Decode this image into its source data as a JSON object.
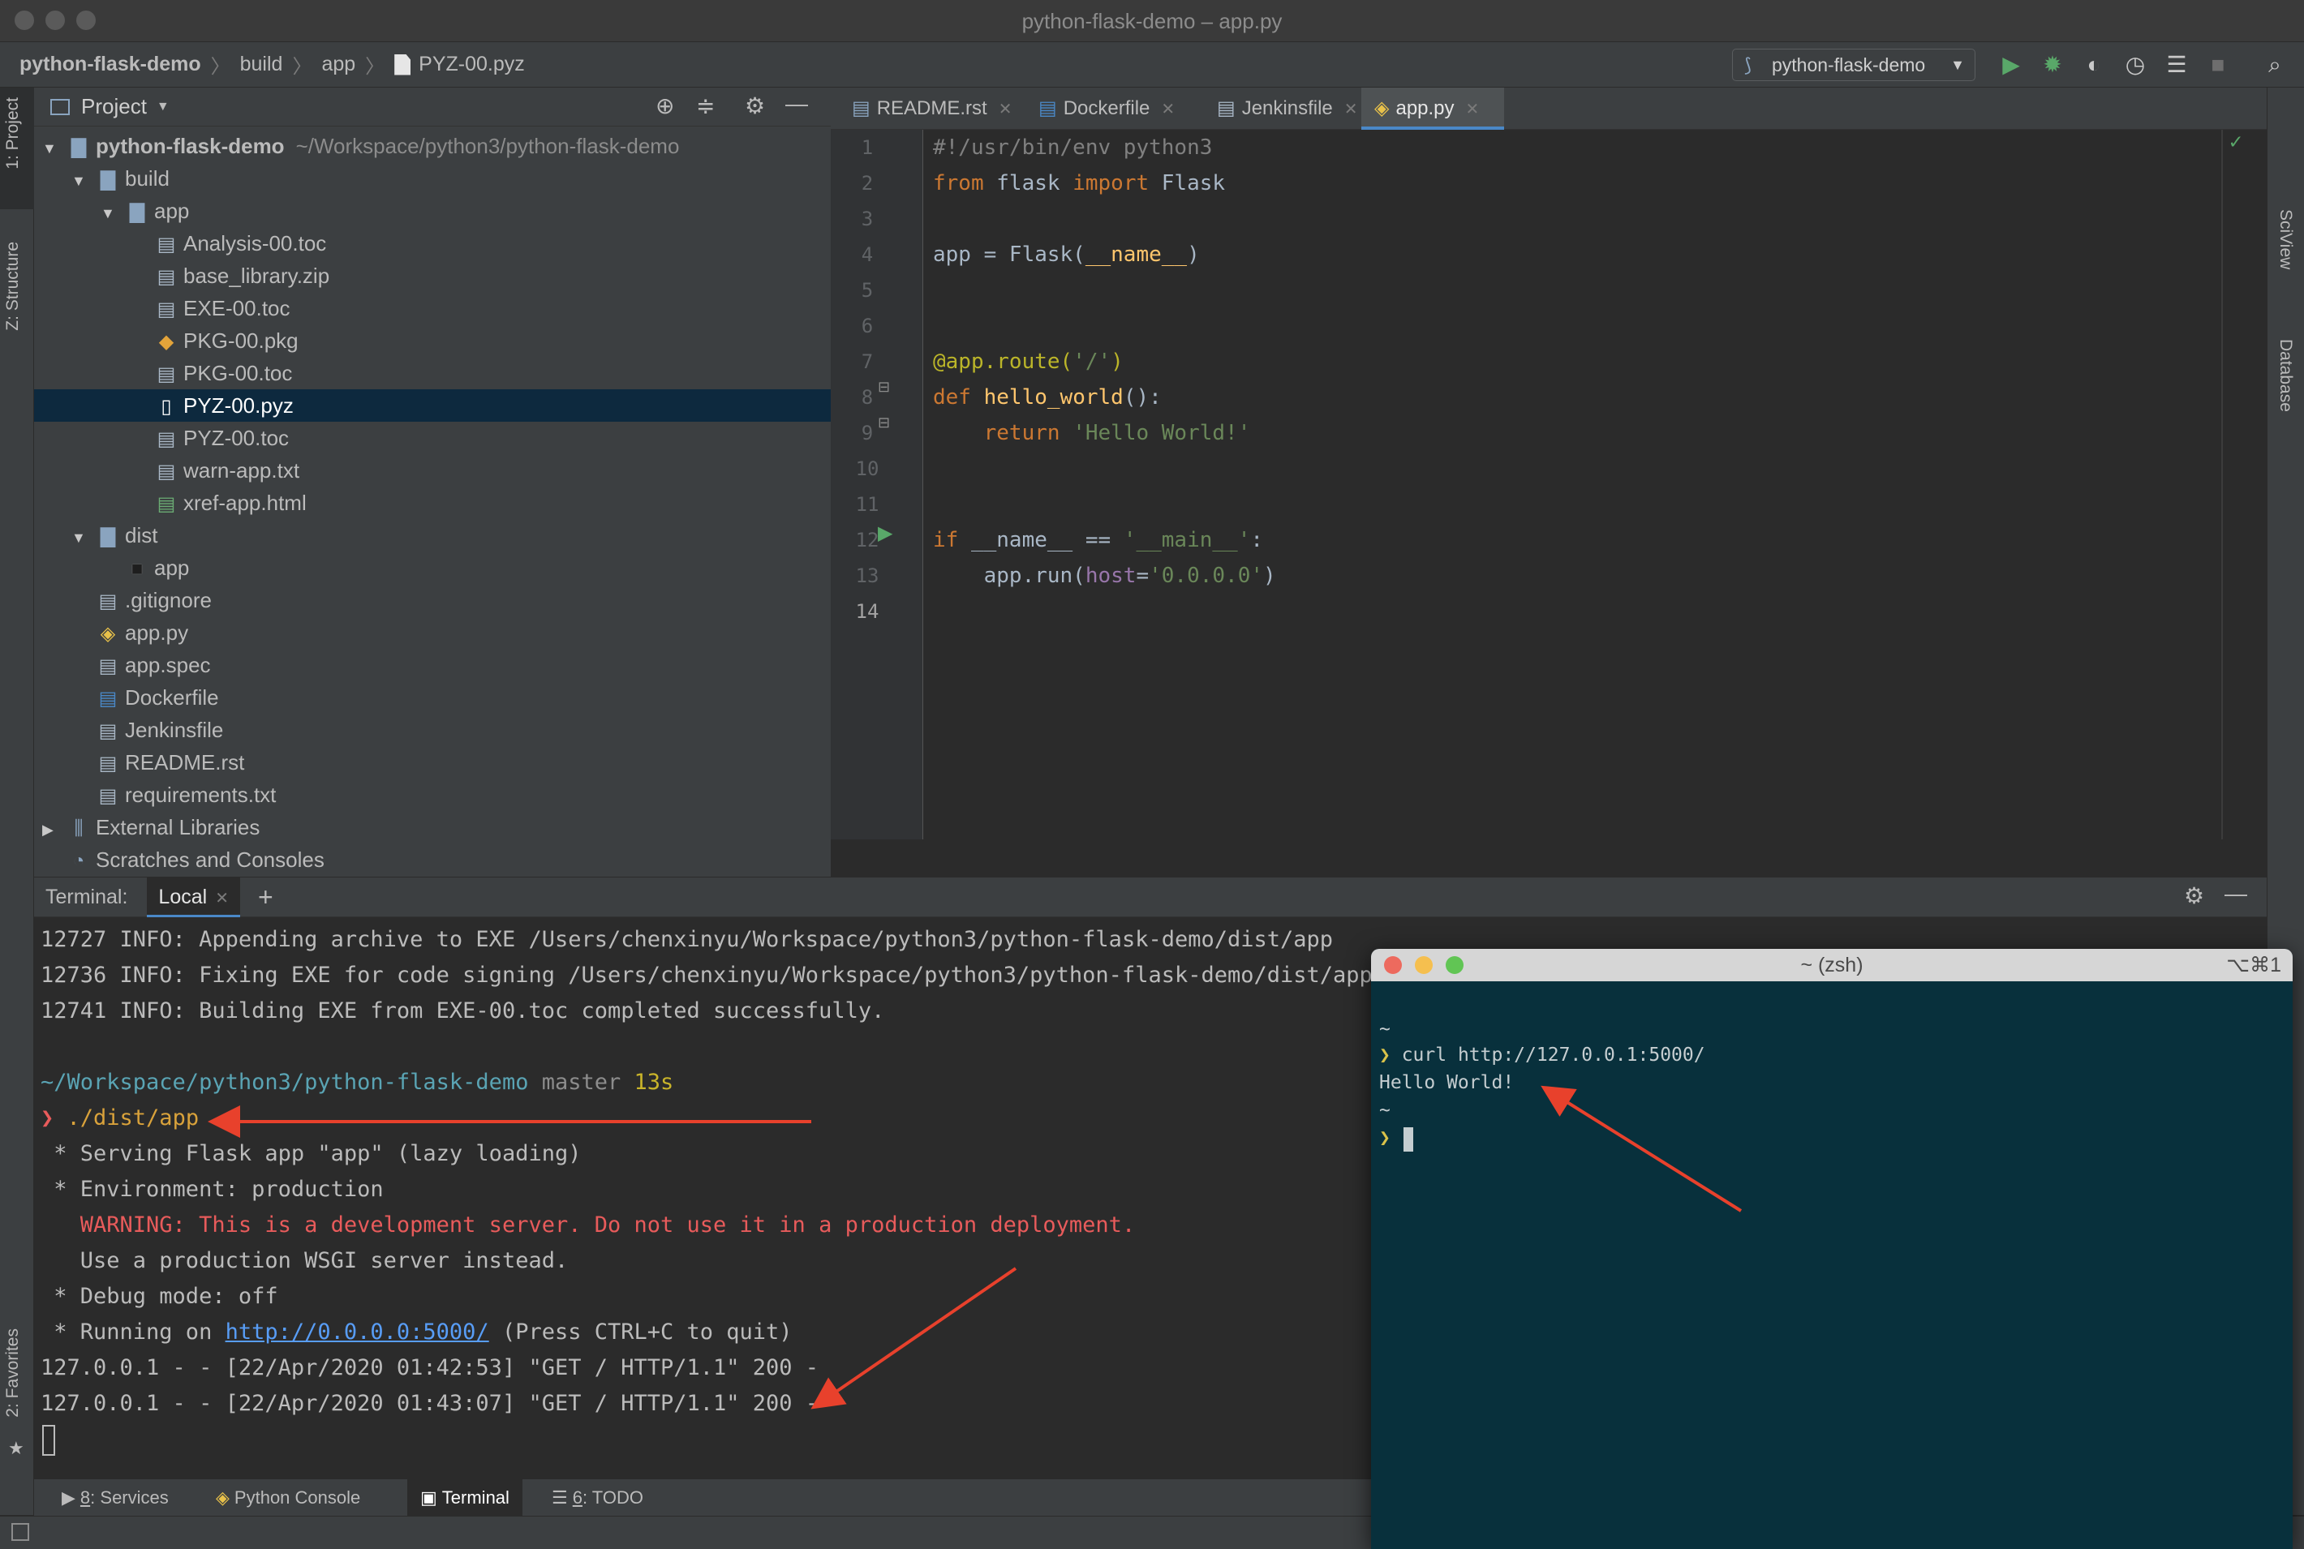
{
  "window": {
    "title": "python-flask-demo – app.py"
  },
  "navbar": {
    "breadcrumbs": [
      "python-flask-demo",
      "build",
      "app",
      "PYZ-00.pyz"
    ],
    "run_config": "python-flask-demo",
    "icons": [
      "run-icon",
      "debug-icon",
      "coverage-icon",
      "profile-icon",
      "run-list-icon",
      "stop-icon",
      "search-icon"
    ]
  },
  "left_strip": {
    "project_tab": "1: Project",
    "structure_tab": "Z: Structure",
    "favorites_tab": "2: Favorites"
  },
  "right_strip": {
    "sciview_tab": "SciView",
    "database_tab": "Database"
  },
  "project_panel": {
    "title": "Project",
    "tree": [
      {
        "label": "python-flask-demo",
        "hint": "~/Workspace/python3/python-flask-demo",
        "type": "folder",
        "expanded": true
      },
      {
        "label": "build",
        "type": "folder",
        "expanded": true
      },
      {
        "label": "app",
        "type": "folder",
        "expanded": true
      },
      {
        "label": "Analysis-00.toc",
        "type": "file"
      },
      {
        "label": "base_library.zip",
        "type": "file"
      },
      {
        "label": "EXE-00.toc",
        "type": "file"
      },
      {
        "label": "PKG-00.pkg",
        "type": "package"
      },
      {
        "label": "PKG-00.toc",
        "type": "file"
      },
      {
        "label": "PYZ-00.pyz",
        "type": "file",
        "selected": true
      },
      {
        "label": "PYZ-00.toc",
        "type": "file"
      },
      {
        "label": "warn-app.txt",
        "type": "text"
      },
      {
        "label": "xref-app.html",
        "type": "html"
      },
      {
        "label": "dist",
        "type": "folder",
        "expanded": true
      },
      {
        "label": "app",
        "type": "executable"
      },
      {
        "label": ".gitignore",
        "type": "text"
      },
      {
        "label": "app.py",
        "type": "python"
      },
      {
        "label": "app.spec",
        "type": "file"
      },
      {
        "label": "Dockerfile",
        "type": "docker"
      },
      {
        "label": "Jenkinsfile",
        "type": "file"
      },
      {
        "label": "README.rst",
        "type": "rst"
      },
      {
        "label": "requirements.txt",
        "type": "text"
      },
      {
        "label": "External Libraries",
        "type": "library",
        "expanded": false
      },
      {
        "label": "Scratches and Consoles",
        "type": "scratch"
      }
    ]
  },
  "editor": {
    "tabs": [
      {
        "label": "README.rst",
        "active": false
      },
      {
        "label": "Dockerfile",
        "active": false
      },
      {
        "label": "Jenkinsfile",
        "active": false
      },
      {
        "label": "app.py",
        "active": true
      }
    ],
    "line_numbers": [
      "1",
      "2",
      "3",
      "4",
      "5",
      "6",
      "7",
      "8",
      "9",
      "10",
      "11",
      "12",
      "13",
      "14"
    ],
    "code": {
      "l1": "#!/usr/bin/env python3",
      "l2_kw1": "from",
      "l2_mod": " flask ",
      "l2_kw2": "import",
      "l2_name": " Flask",
      "l4_a": "app = Flask(",
      "l4_b": "__name__",
      "l4_c": ")",
      "l7_dec": "@app.route(",
      "l7_str": "'/'",
      "l7_end": ")",
      "l8_kw": "def",
      "l8_fn": " hello_world",
      "l8_end": "():",
      "l9_kw": "    return",
      "l9_str": " 'Hello World!'",
      "l12_kw": "if",
      "l12_a": " __name__ == ",
      "l12_str": "'__main__'",
      "l12_end": ":",
      "l13_a": "    app.run(",
      "l13_par": "host",
      "l13_eq": "=",
      "l13_str": "'0.0.0.0'",
      "l13_end": ")"
    }
  },
  "terminal": {
    "label": "Terminal:",
    "tab": "Local",
    "lines": {
      "t1": "12727 INFO: Appending archive to EXE /Users/chenxinyu/Workspace/python3/python-flask-demo/dist/app",
      "t2": "12736 INFO: Fixing EXE for code signing /Users/chenxinyu/Workspace/python3/python-flask-demo/dist/app",
      "t3": "12741 INFO: Building EXE from EXE-00.toc completed successfully.",
      "p_path": "~/Workspace/python3/python-flask-demo",
      "p_branch": " master",
      "p_time": " 13s",
      "cmd_prompt": "❯",
      "cmd": " ./dist/app",
      "s1": " * Serving Flask app \"app\" (lazy loading)",
      "s2": " * Environment: production",
      "s3": "   WARNING: This is a development server. Do not use it in a production deployment.",
      "s4": "   Use a production WSGI server instead.",
      "s5": " * Debug mode: off",
      "s6a": " * Running on ",
      "s6b": "http://0.0.0.0:5000/",
      "s6c": " (Press CTRL+C to quit)",
      "r1": "127.0.0.1 - - [22/Apr/2020 01:42:53] \"GET / HTTP/1.1\" 200 -",
      "r2": "127.0.0.1 - - [22/Apr/2020 01:43:07] \"GET / HTTP/1.1\" 200 -"
    }
  },
  "bottom_tabs": [
    {
      "num": "8",
      "label": ": Services"
    },
    {
      "label": "Python Console"
    },
    {
      "label": "Terminal",
      "active": true
    },
    {
      "num": "6",
      "label": ": TODO"
    }
  ],
  "zsh": {
    "title": "~ (zsh)",
    "shortcut": "⌥⌘1",
    "lines": {
      "z1": "~",
      "z2a": "❯",
      "z2b": " curl http://127.0.0.1:5000/",
      "z3": "Hello World!",
      "z4": "~",
      "z5": "❯"
    }
  },
  "colors": {
    "accent": "#4a88c7",
    "arrow": "#e8412c",
    "terminal_bg": "#08303c",
    "selection": "#0d293e"
  }
}
